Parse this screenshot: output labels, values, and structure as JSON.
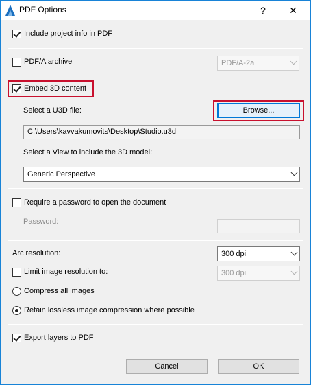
{
  "window": {
    "title": "PDF Options",
    "help_glyph": "?",
    "close_glyph": "✕"
  },
  "options": {
    "include_project_info": {
      "label": "Include project info in PDF",
      "checked": true
    },
    "pdfa_archive": {
      "label": "PDF/A archive",
      "checked": false,
      "select_value": "PDF/A-2a"
    },
    "embed_3d": {
      "label": "Embed 3D content",
      "checked": true
    },
    "u3d": {
      "label": "Select a U3D file:",
      "browse_label": "Browse...",
      "path": "C:\\Users\\kavvakumovits\\Desktop\\Studio.u3d"
    },
    "view": {
      "label": "Select a View to include the 3D model:",
      "select_value": "Generic Perspective"
    },
    "password": {
      "require_label": "Require a password to open the document",
      "checked": false,
      "field_label": "Password:",
      "value": ""
    },
    "arc_resolution": {
      "label": "Arc resolution:",
      "select_value": "300 dpi"
    },
    "limit_image_res": {
      "label": "Limit image resolution to:",
      "checked": false,
      "select_value": "300 dpi"
    },
    "compress_all": {
      "label": "Compress all images",
      "selected": false
    },
    "retain_lossless": {
      "label": "Retain lossless image compression where possible",
      "selected": true
    },
    "export_layers": {
      "label": "Export layers to PDF",
      "checked": true
    }
  },
  "buttons": {
    "cancel": "Cancel",
    "ok": "OK"
  },
  "colors": {
    "highlight_box": "#c8102e",
    "accent": "#0078d7",
    "window_border": "#1883d7"
  }
}
